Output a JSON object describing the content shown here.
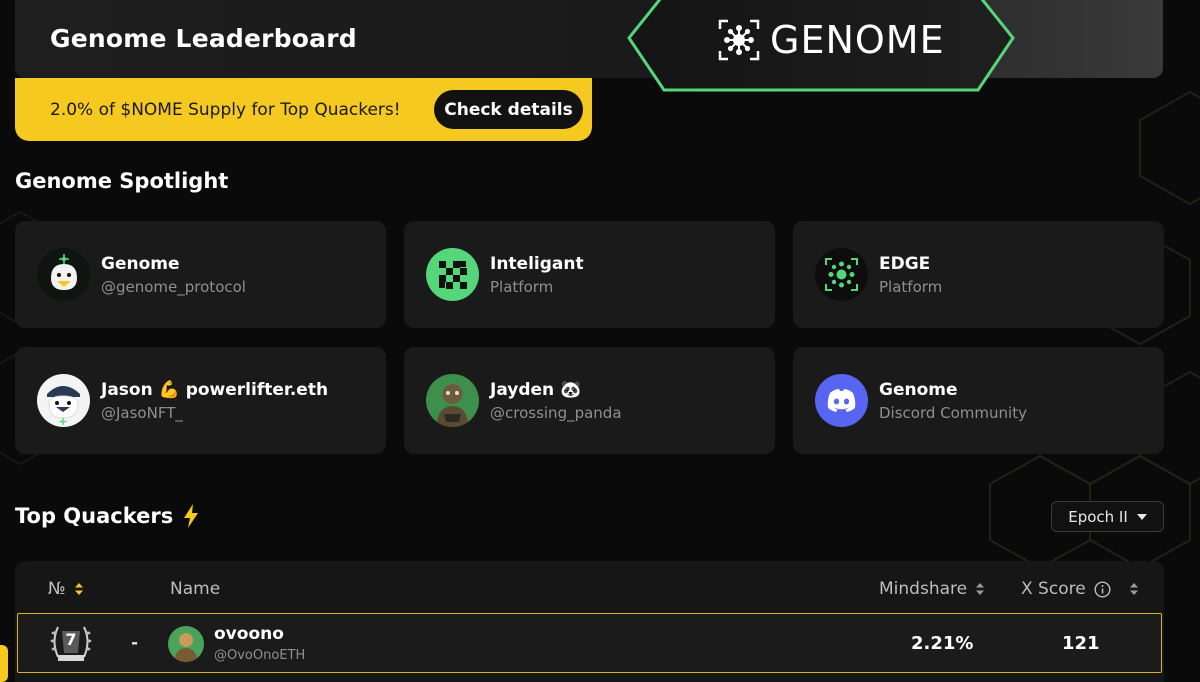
{
  "header": {
    "title": "Genome Leaderboard",
    "logo_text": "GENOME"
  },
  "banner": {
    "text": "2.0% of $NOME Supply for Top Quackers!",
    "button_label": "Check details"
  },
  "spotlight": {
    "title": "Genome Spotlight",
    "cards": [
      {
        "name": "Genome",
        "sub": "@genome_protocol",
        "avatar": "duck-icon"
      },
      {
        "name": "Inteligant",
        "sub": "Platform",
        "avatar": "checker-icon"
      },
      {
        "name": "EDGE",
        "sub": "Platform",
        "avatar": "genome-logo-icon"
      },
      {
        "name": "Jason 💪 powerlifter.eth",
        "sub": "@JasoNFT_",
        "avatar": "duck-cap-icon"
      },
      {
        "name": "Jayden 🐼",
        "sub": "@crossing_panda",
        "avatar": "character-avatar"
      },
      {
        "name": "Genome",
        "sub": "Discord Community",
        "avatar": "discord-icon"
      }
    ]
  },
  "leaderboard": {
    "title": "Top Quackers",
    "epoch": "Epoch II",
    "columns": {
      "rank": "№",
      "name": "Name",
      "mindshare": "Mindshare",
      "xscore": "X Score"
    },
    "rows": [
      {
        "rank": "7",
        "change": "-",
        "name": "ovoono",
        "handle": "@OvoOnoETH",
        "mindshare": "2.21%",
        "xscore": "121"
      }
    ]
  },
  "colors": {
    "accent_yellow": "#f5c920",
    "accent_green": "#55d67a",
    "discord_blue": "#5865f2",
    "bg": "#0a0a0a"
  }
}
